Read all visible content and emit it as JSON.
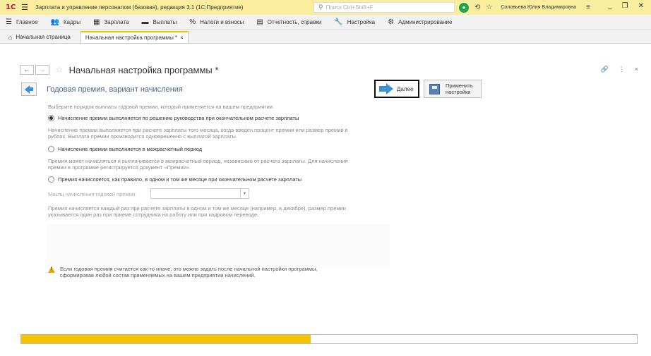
{
  "titlebar": {
    "app_title": "Зарплата и управление персоналом (базовая), редакция 3.1  (1С:Предприятие)",
    "search_placeholder": "Поиск Ctrl+Shift+F",
    "user": "Соловьева Юлия Владимировна"
  },
  "menu": {
    "items": [
      {
        "label": "Главное",
        "icon": "menu-lines-icon"
      },
      {
        "label": "Кадры",
        "icon": "people-icon"
      },
      {
        "label": "Зарплата",
        "icon": "calculator-icon"
      },
      {
        "label": "Выплаты",
        "icon": "money-icon"
      },
      {
        "label": "Налоги и взносы",
        "icon": "percent-icon"
      },
      {
        "label": "Отчетность, справки",
        "icon": "report-icon"
      },
      {
        "label": "Настройка",
        "icon": "wrench-icon"
      },
      {
        "label": "Администрирование",
        "icon": "gear-icon"
      }
    ]
  },
  "tabs": {
    "home": "Начальная страница",
    "active": "Начальная настройка программы *"
  },
  "form": {
    "title": "Начальная настройка программы *",
    "step_title": "Годовая премия,  вариант начисления",
    "next_label": "Далее",
    "apply_label_1": "Применить",
    "apply_label_2": "настройки"
  },
  "content": {
    "intro": "Выберите порядок выплаты годовой премии, который применяется на вашем предприятии.",
    "option1": "Начисление премии выполняется по решению руководства при окончательном расчете зарплаты",
    "desc1_l1": "Начисление премии выполняется при расчете зарплаты того месяца, когда введен процент премии или размер премии в",
    "desc1_l2": "рублях. Выплата премии производится одновременно с выплатой зарплаты.",
    "option2": "Начисление премии выполняется в межрасчетный период",
    "desc2_l1": "Премия может начисляться и выплачивается в межрасчетный период, независимо от расчета зарплаты. Для начисления",
    "desc2_l2": "премии в программе регистрируется документ «Премии».",
    "option3": "Премия начисляется, как правило, в одном и том же месяце при окончательном расчете зарплаты",
    "month_label": "Месяц начисления годовой премии:",
    "month_value": "",
    "desc3_l1": "Премия начисляется каждый раз при расчете зарплаты в одном и том же месяце (например, в декабре), размер премии",
    "desc3_l2": "указывается один раз при приеме сотрудника на работу или при кадровом переводе.",
    "warn_l1": "Если годовая премия считается как-то иначе, это можно задать после начальной настройки программы,",
    "warn_l2": "сформировав любой состав применяемых на вашем предприятии начислений.",
    "selected_option": 1
  },
  "progress": {
    "fraction": 0.47
  },
  "colors": {
    "accent": "#f5c400",
    "titlebar": "#fbed9e",
    "link_blue": "#3d8fd6"
  }
}
